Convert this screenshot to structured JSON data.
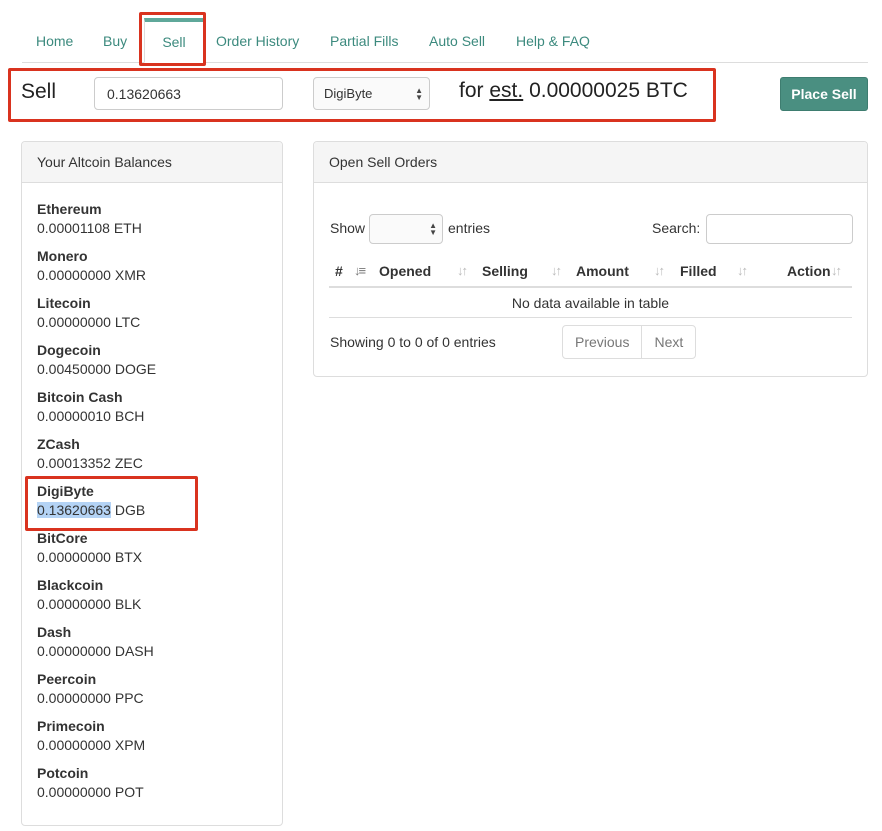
{
  "nav": {
    "tabs": [
      {
        "label": "Home"
      },
      {
        "label": "Buy"
      },
      {
        "label": "Sell"
      },
      {
        "label": "Order History"
      },
      {
        "label": "Partial Fills"
      },
      {
        "label": "Auto Sell"
      },
      {
        "label": "Help & FAQ"
      }
    ],
    "active_tab": "Sell"
  },
  "sell_form": {
    "label": "Sell",
    "amount_value": "0.13620663",
    "coin_selected": "DigiByte",
    "est_prefix": "for",
    "est_word": "est.",
    "est_amount": "0.00000025 BTC",
    "place_button": "Place Sell"
  },
  "balances": {
    "title": "Your Altcoin Balances",
    "items": [
      {
        "name": "Ethereum",
        "value": "0.00001108 ETH"
      },
      {
        "name": "Monero",
        "value": "0.00000000 XMR"
      },
      {
        "name": "Litecoin",
        "value": "0.00000000 LTC"
      },
      {
        "name": "Dogecoin",
        "value": "0.00450000 DOGE"
      },
      {
        "name": "Bitcoin Cash",
        "value": "0.00000010 BCH"
      },
      {
        "name": "ZCash",
        "value": "0.00013352 ZEC"
      },
      {
        "name": "DigiByte",
        "value_highlighted": "0.13620663",
        "value_rest": " DGB"
      },
      {
        "name": "BitCore",
        "value": "0.00000000 BTX"
      },
      {
        "name": "Blackcoin",
        "value": "0.00000000 BLK"
      },
      {
        "name": "Dash",
        "value": "0.00000000 DASH"
      },
      {
        "name": "Peercoin",
        "value": "0.00000000 PPC"
      },
      {
        "name": "Primecoin",
        "value": "0.00000000 XPM"
      },
      {
        "name": "Potcoin",
        "value": "0.00000000 POT"
      }
    ]
  },
  "orders": {
    "title": "Open Sell Orders",
    "show_label": "Show",
    "entries_label": "entries",
    "search_label": "Search:",
    "columns": [
      "#",
      "Opened",
      "Selling",
      "Amount",
      "Filled",
      "Action"
    ],
    "empty_text": "No data available in table",
    "info": "Showing 0 to 0 of 0 entries",
    "prev_label": "Previous",
    "next_label": "Next"
  },
  "colors": {
    "accent": "#4a8f81",
    "link": "#3c8a7e",
    "highlight_box": "#d9331f"
  }
}
